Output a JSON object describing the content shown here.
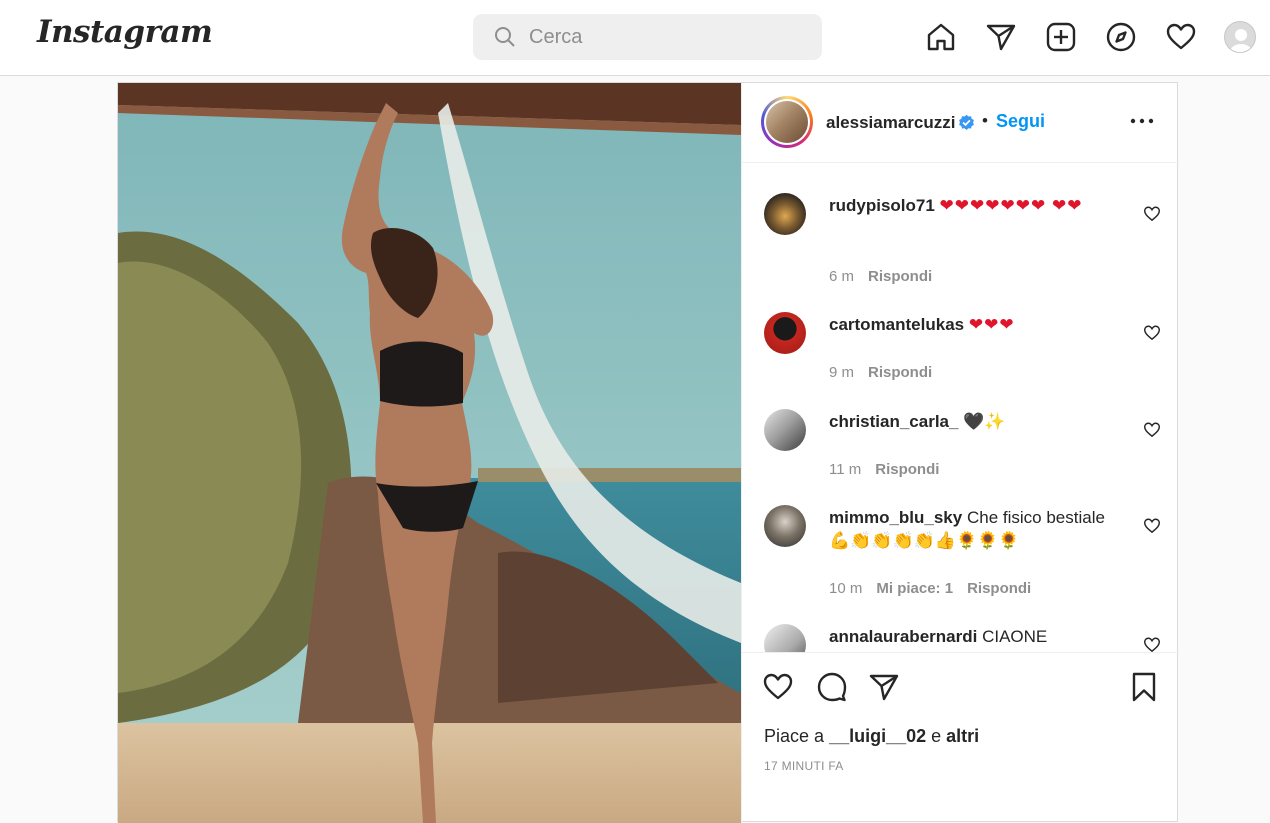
{
  "nav": {
    "logo": "Instagram",
    "search_placeholder": "Cerca",
    "icons": [
      "home-icon",
      "direct-message-icon",
      "new-post-icon",
      "explore-icon",
      "activity-heart-icon",
      "profile-avatar"
    ]
  },
  "post": {
    "author": "alessiamarcuzzi",
    "verified": true,
    "separator": "•",
    "follow_label": "Segui",
    "likes_prefix": "Piace a",
    "likes_user": "__luigi__02",
    "likes_suffix_e": "e",
    "likes_others": "altri",
    "timestamp": "17 MINUTI FA"
  },
  "comments": [
    {
      "user": "rudypisolo71",
      "text": "",
      "emoji": "❤❤❤❤❤❤❤ ❤❤",
      "time": "6 m",
      "likes": "",
      "reply": "Rispondi"
    },
    {
      "user": "cartomantelukas",
      "text": "",
      "emoji": "❤❤❤",
      "time": "9 m",
      "likes": "",
      "reply": "Rispondi"
    },
    {
      "user": "christian_carla_",
      "text": "",
      "emoji": "🖤✨",
      "time": "11 m",
      "likes": "",
      "reply": "Rispondi"
    },
    {
      "user": "mimmo_blu_sky",
      "text": "Che fisico bestiale",
      "emoji": "💪👏👏👏👏👍🌻🌻🌻",
      "time": "10 m",
      "likes": "Mi piace: 1",
      "reply": "Rispondi"
    },
    {
      "user": "annalaurabernardi",
      "text": "CIAONE",
      "emoji": "",
      "time": "",
      "likes": "",
      "reply": ""
    }
  ],
  "colors": {
    "accent": "#0095f6",
    "heart_red": "#e0152b",
    "muted": "#8e8e8e"
  }
}
